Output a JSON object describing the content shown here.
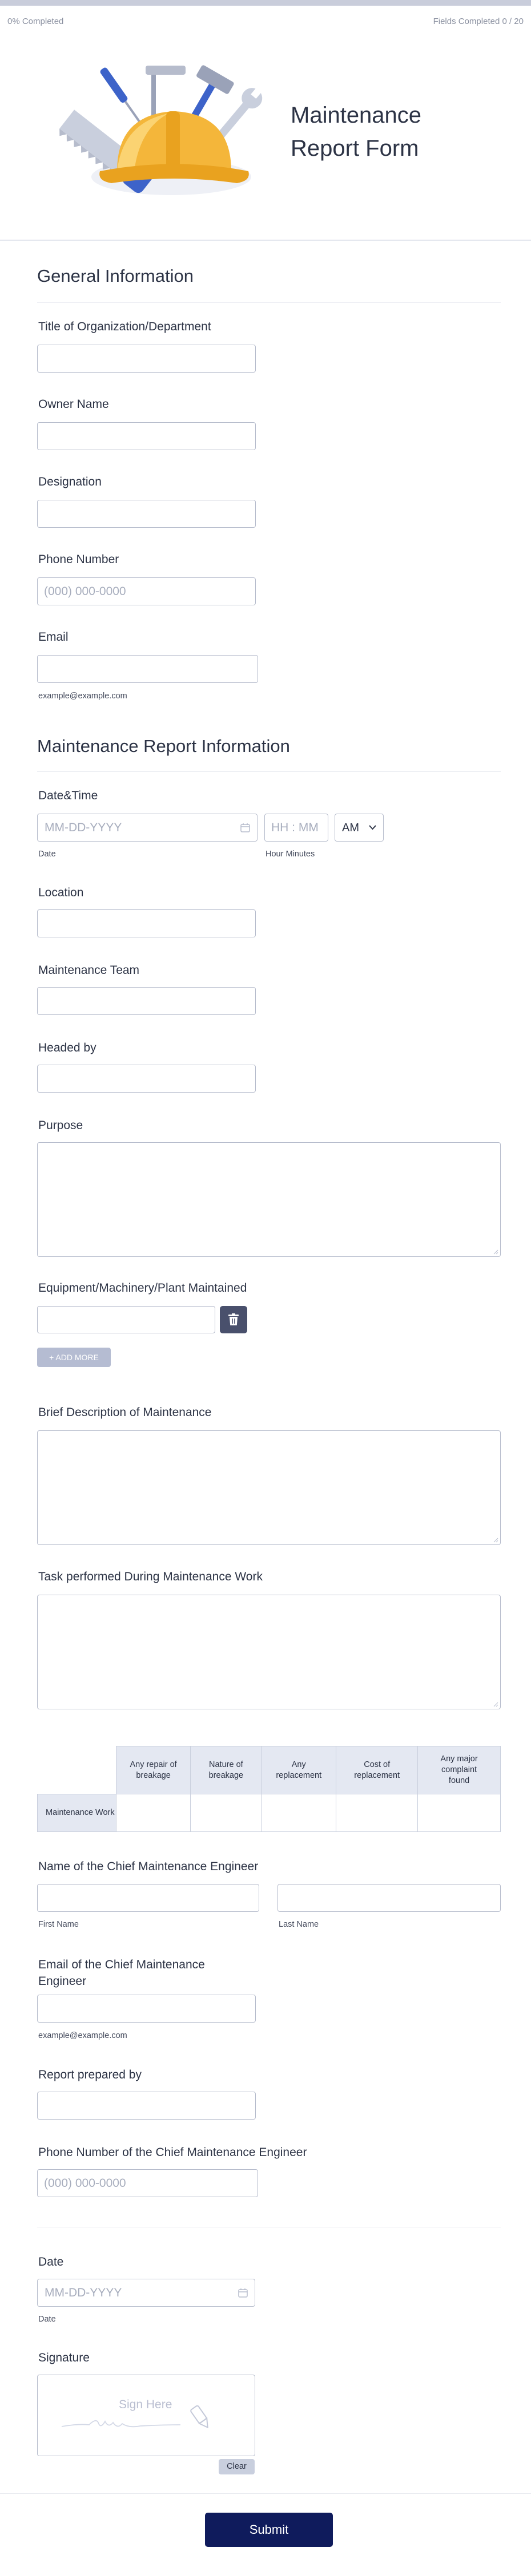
{
  "progress": {
    "percent_text": "0% Completed",
    "fields_text": "Fields Completed  0 / 20",
    "fraction": 0
  },
  "header": {
    "title_line1": "Maintenance",
    "title_line2": "Report Form"
  },
  "general": {
    "title": "General Information",
    "org_label": "Title of Organization/Department",
    "owner_label": "Owner Name",
    "designation_label": "Designation",
    "phone_label": "Phone Number",
    "phone_placeholder": "(000) 000-0000",
    "email_label": "Email",
    "email_hint": "example@example.com"
  },
  "report": {
    "title": "Maintenance Report Information",
    "datetime_label": "Date&Time",
    "date_placeholder": "MM-DD-YYYY",
    "date_sub": "Date",
    "time_placeholder": "HH : MM",
    "time_sub": "Hour Minutes",
    "ampm_value": "AM",
    "location_label": "Location",
    "team_label": "Maintenance Team",
    "headed_label": "Headed by",
    "purpose_label": "Purpose",
    "equipment_label": "Equipment/Machinery/Plant Maintained",
    "add_more_label": "+ ADD MORE",
    "brief_label": "Brief Description of Maintenance",
    "task_label": "Task performed During Maintenance Work",
    "matrix": {
      "columns": [
        "Any repair of breakage",
        "Nature of breakage",
        "Any replacement",
        "Cost of replacement",
        "Any major complaint found"
      ],
      "row_label": "Maintenance Work"
    },
    "engineer_name_label": "Name of the Chief Maintenance Engineer",
    "first_name_sub": "First Name",
    "last_name_sub": "Last Name",
    "engineer_email_label_line1": "Email of the Chief Maintenance",
    "engineer_email_label_line2": "Engineer",
    "engineer_email_hint": "example@example.com",
    "prepared_label": "Report prepared by",
    "engineer_phone_label": "Phone Number of the Chief Maintenance Engineer",
    "engineer_phone_placeholder": "(000) 000-0000"
  },
  "final": {
    "date_label": "Date",
    "date_placeholder": "MM-DD-YYYY",
    "date_sub": "Date",
    "signature_label": "Signature",
    "signature_placeholder": "Sign Here",
    "clear_label": "Clear",
    "submit_label": "Submit"
  },
  "colors": {
    "accent": "#0f1b5c",
    "delete_button": "#49506c",
    "progress_track": "#c9cddb"
  }
}
